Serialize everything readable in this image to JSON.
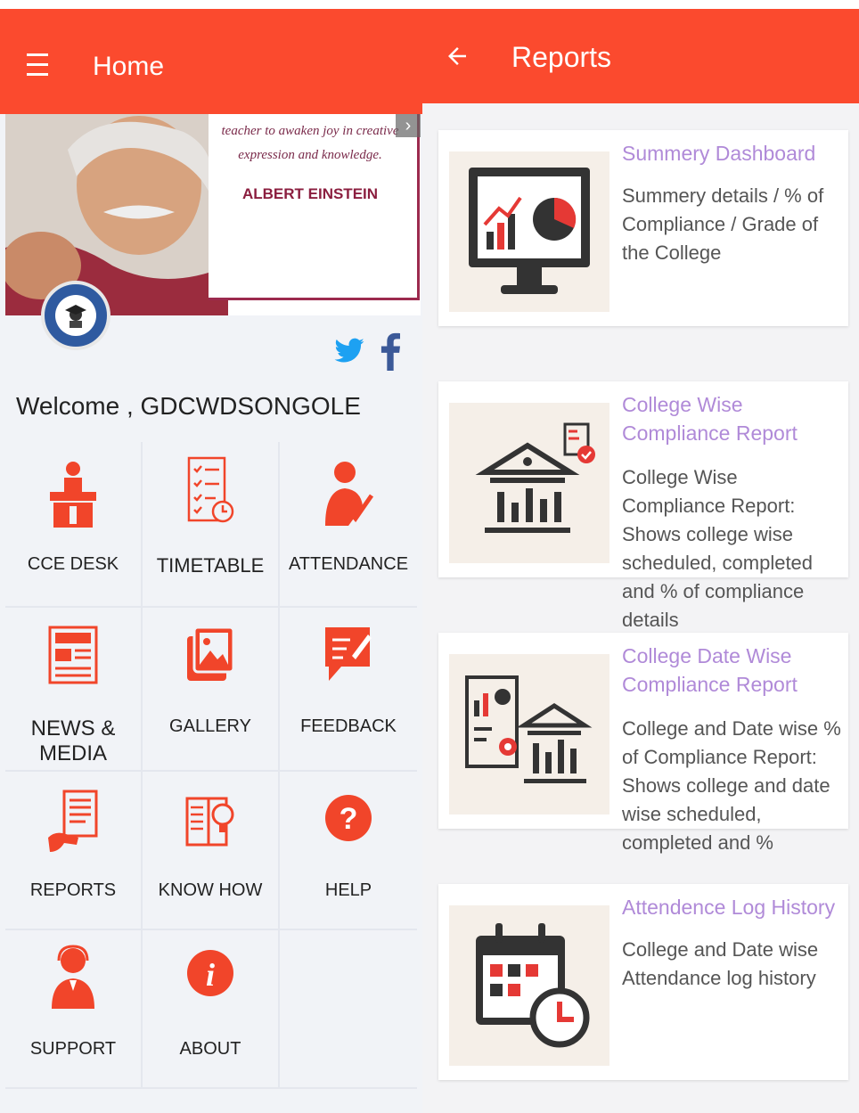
{
  "home": {
    "title": "Home",
    "quote_text": "teacher to awaken joy in creative expression and knowledge.",
    "quote_author": "ALBERT EINSTEIN",
    "welcome": "Welcome , GDCWDSONGOLE",
    "tiles": [
      {
        "label": "CCE DESK",
        "icon": "desk-icon"
      },
      {
        "label": "TIMETABLE",
        "icon": "timetable-icon"
      },
      {
        "label": "ATTENDANCE",
        "icon": "attendance-icon"
      },
      {
        "label": "NEWS & MEDIA",
        "icon": "news-icon"
      },
      {
        "label": "GALLERY",
        "icon": "gallery-icon"
      },
      {
        "label": "FEEDBACK",
        "icon": "feedback-icon"
      },
      {
        "label": "REPORTS",
        "icon": "reports-icon"
      },
      {
        "label": "KNOW HOW",
        "icon": "know-how-icon"
      },
      {
        "label": "HELP",
        "icon": "help-icon"
      },
      {
        "label": "SUPPORT",
        "icon": "support-icon"
      },
      {
        "label": "ABOUT",
        "icon": "about-icon"
      }
    ]
  },
  "reports": {
    "title": "Reports",
    "cards": [
      {
        "title": "Summery Dashboard",
        "desc": "Summery details / % of Compliance / Grade of the College"
      },
      {
        "title": "College Wise Compliance Report",
        "desc": "College Wise Compliance Report: Shows college wise scheduled, completed and % of compliance details"
      },
      {
        "title": "College Date Wise Compliance Report",
        "desc": "College and Date wise % of Compliance Report: Shows college and date wise scheduled, completed and %"
      },
      {
        "title": "Attendence Log History",
        "desc": "College and Date wise Attendance log history"
      }
    ]
  },
  "colors": {
    "accent": "#fb4a2e",
    "card_title": "#b08ad8",
    "twitter": "#1da1f2",
    "facebook": "#3b5998"
  }
}
